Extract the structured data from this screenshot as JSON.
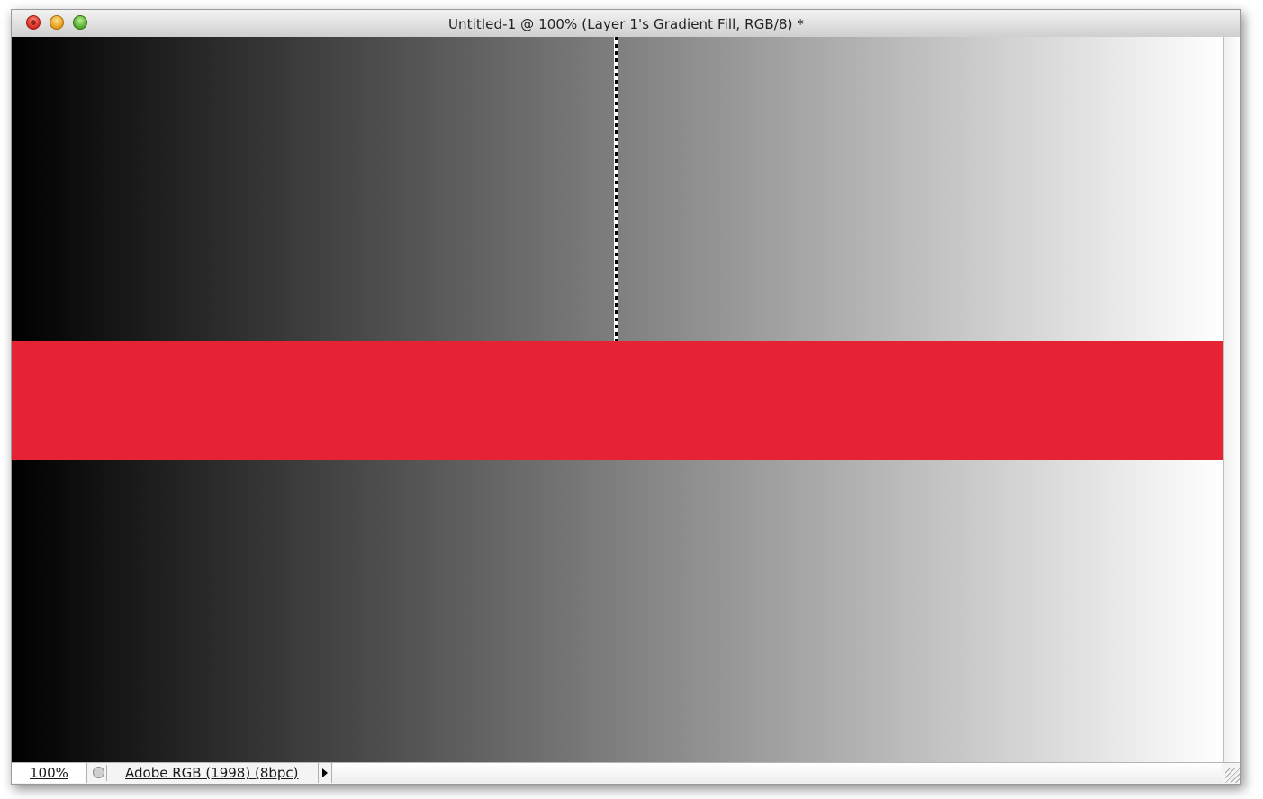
{
  "window": {
    "title": "Untitled-1 @ 100% (Layer 1's Gradient Fill, RGB/8) *",
    "buttons": [
      "close",
      "minimize",
      "zoom"
    ]
  },
  "canvas": {
    "gradient_colors": [
      "#000000",
      "#ffffff"
    ],
    "band_color": "#e62334",
    "selection": "marching-ants-vertical-line"
  },
  "statusbar": {
    "zoom": "100%",
    "doc_info": "Adobe RGB (1998) (8bpc)"
  }
}
